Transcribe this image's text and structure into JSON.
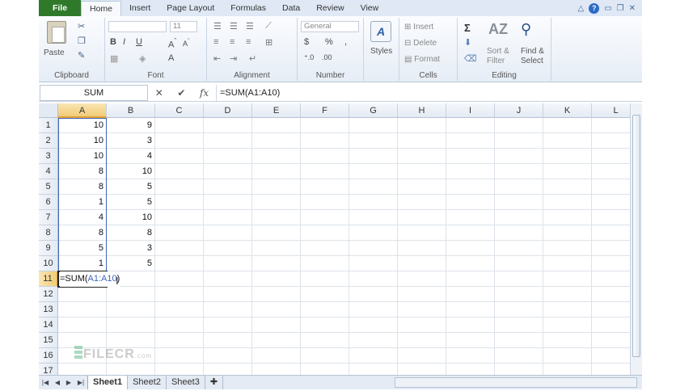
{
  "ribbon": {
    "tabs": [
      "File",
      "Home",
      "Insert",
      "Page Layout",
      "Formulas",
      "Data",
      "Review",
      "View"
    ],
    "active_tab": "Home",
    "groups": {
      "clipboard": {
        "label": "Clipboard",
        "paste": "Paste"
      },
      "font": {
        "label": "Font",
        "size": "11",
        "bold": "B",
        "italic": "I",
        "underline": "U"
      },
      "alignment": {
        "label": "Alignment"
      },
      "number": {
        "label": "Number",
        "format": "General",
        "currency": "$",
        "percent": "%",
        "comma": ",",
        "increase_dec": "⁺.0",
        "decrease_dec": ".00"
      },
      "styles": {
        "label": "Styles"
      },
      "cells": {
        "label": "Cells",
        "insert": "Insert",
        "delete": "Delete",
        "format": "Format"
      },
      "editing": {
        "label": "Editing",
        "sort": "Sort &",
        "filter": "Filter",
        "find": "Find &",
        "select": "Select"
      }
    }
  },
  "formula_bar": {
    "name_box": "SUM",
    "formula": "=SUM(A1:A10)"
  },
  "grid": {
    "columns": [
      "A",
      "B",
      "C",
      "D",
      "E",
      "F",
      "G",
      "H",
      "I",
      "J",
      "K",
      "L"
    ],
    "rows": [
      "1",
      "2",
      "3",
      "4",
      "5",
      "6",
      "7",
      "8",
      "9",
      "10",
      "11",
      "12",
      "13",
      "14",
      "15",
      "16",
      "17"
    ],
    "col_a": [
      "10",
      "10",
      "10",
      "8",
      "8",
      "1",
      "4",
      "8",
      "5",
      "1"
    ],
    "col_b": [
      "9",
      "3",
      "4",
      "10",
      "5",
      "5",
      "10",
      "8",
      "3",
      "5"
    ],
    "editing_cell": {
      "prefix": "=SUM(",
      "ref": "A1:A10",
      "suffix": ")"
    }
  },
  "watermark": {
    "text": "FILECR",
    "suffix": ".com"
  },
  "sheets": [
    "Sheet1",
    "Sheet2",
    "Sheet3"
  ],
  "active_sheet": "Sheet1"
}
